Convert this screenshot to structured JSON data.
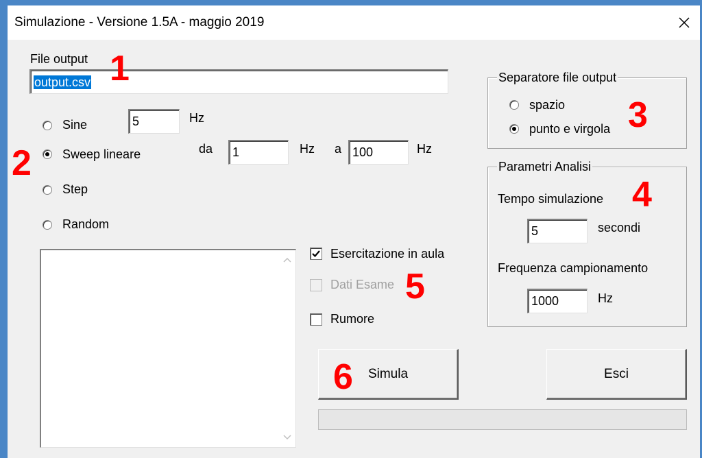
{
  "window": {
    "title": "Simulazione - Versione 1.5A - maggio 2019"
  },
  "file_output": {
    "label": "File output",
    "value": "output.csv"
  },
  "signal": {
    "options": [
      {
        "label": "Sine",
        "checked": false
      },
      {
        "label": "Sweep lineare",
        "checked": true
      },
      {
        "label": "Step",
        "checked": false
      },
      {
        "label": "Random",
        "checked": false
      }
    ],
    "sine_freq": "5",
    "sine_unit": "Hz",
    "sweep_from_label": "da",
    "sweep_from": "1",
    "sweep_from_unit": "Hz",
    "sweep_to_label": "a",
    "sweep_to": "100",
    "sweep_to_unit": "Hz"
  },
  "separator": {
    "title": "Separatore file output",
    "options": [
      {
        "label": "spazio",
        "checked": false
      },
      {
        "label": "punto e virgola",
        "checked": true
      }
    ]
  },
  "params": {
    "title": "Parametri Analisi",
    "tempo_label": "Tempo simulazione",
    "tempo_value": "5",
    "tempo_unit": "secondi",
    "freq_label": "Frequenza campionamento",
    "freq_value": "1000",
    "freq_unit": "Hz"
  },
  "checkboxes": [
    {
      "label": "Esercitazione in aula",
      "checked": true,
      "enabled": true
    },
    {
      "label": "Dati Esame",
      "checked": false,
      "enabled": false
    },
    {
      "label": "Rumore",
      "checked": false,
      "enabled": true
    }
  ],
  "buttons": {
    "simula": "Simula",
    "esci": "Esci"
  },
  "annotations": [
    "1",
    "2",
    "3",
    "4",
    "5",
    "6"
  ],
  "progress": 0,
  "colors": {
    "annotation": "#ff0000",
    "selection": "#0078d7",
    "window_border": "#4a86c6"
  }
}
